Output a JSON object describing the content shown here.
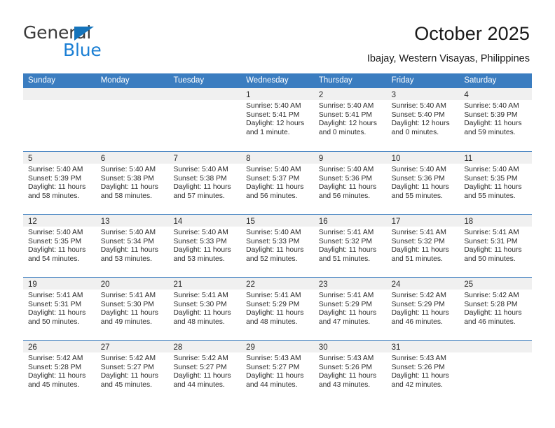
{
  "brand": {
    "name_part1": "General",
    "name_part2": "Blue",
    "accent_color": "#1b7fd4"
  },
  "header": {
    "title": "October 2025",
    "subtitle": "Ibajay, Western Visayas, Philippines"
  },
  "calendar": {
    "header_bg": "#3b7dc0",
    "weekdays": [
      "Sunday",
      "Monday",
      "Tuesday",
      "Wednesday",
      "Thursday",
      "Friday",
      "Saturday"
    ],
    "weeks": [
      [
        {
          "day": "",
          "sunrise": "",
          "sunset": "",
          "daylight1": "",
          "daylight2": ""
        },
        {
          "day": "",
          "sunrise": "",
          "sunset": "",
          "daylight1": "",
          "daylight2": ""
        },
        {
          "day": "",
          "sunrise": "",
          "sunset": "",
          "daylight1": "",
          "daylight2": ""
        },
        {
          "day": "1",
          "sunrise": "Sunrise: 5:40 AM",
          "sunset": "Sunset: 5:41 PM",
          "daylight1": "Daylight: 12 hours",
          "daylight2": "and 1 minute."
        },
        {
          "day": "2",
          "sunrise": "Sunrise: 5:40 AM",
          "sunset": "Sunset: 5:41 PM",
          "daylight1": "Daylight: 12 hours",
          "daylight2": "and 0 minutes."
        },
        {
          "day": "3",
          "sunrise": "Sunrise: 5:40 AM",
          "sunset": "Sunset: 5:40 PM",
          "daylight1": "Daylight: 12 hours",
          "daylight2": "and 0 minutes."
        },
        {
          "day": "4",
          "sunrise": "Sunrise: 5:40 AM",
          "sunset": "Sunset: 5:39 PM",
          "daylight1": "Daylight: 11 hours",
          "daylight2": "and 59 minutes."
        }
      ],
      [
        {
          "day": "5",
          "sunrise": "Sunrise: 5:40 AM",
          "sunset": "Sunset: 5:39 PM",
          "daylight1": "Daylight: 11 hours",
          "daylight2": "and 58 minutes."
        },
        {
          "day": "6",
          "sunrise": "Sunrise: 5:40 AM",
          "sunset": "Sunset: 5:38 PM",
          "daylight1": "Daylight: 11 hours",
          "daylight2": "and 58 minutes."
        },
        {
          "day": "7",
          "sunrise": "Sunrise: 5:40 AM",
          "sunset": "Sunset: 5:38 PM",
          "daylight1": "Daylight: 11 hours",
          "daylight2": "and 57 minutes."
        },
        {
          "day": "8",
          "sunrise": "Sunrise: 5:40 AM",
          "sunset": "Sunset: 5:37 PM",
          "daylight1": "Daylight: 11 hours",
          "daylight2": "and 56 minutes."
        },
        {
          "day": "9",
          "sunrise": "Sunrise: 5:40 AM",
          "sunset": "Sunset: 5:36 PM",
          "daylight1": "Daylight: 11 hours",
          "daylight2": "and 56 minutes."
        },
        {
          "day": "10",
          "sunrise": "Sunrise: 5:40 AM",
          "sunset": "Sunset: 5:36 PM",
          "daylight1": "Daylight: 11 hours",
          "daylight2": "and 55 minutes."
        },
        {
          "day": "11",
          "sunrise": "Sunrise: 5:40 AM",
          "sunset": "Sunset: 5:35 PM",
          "daylight1": "Daylight: 11 hours",
          "daylight2": "and 55 minutes."
        }
      ],
      [
        {
          "day": "12",
          "sunrise": "Sunrise: 5:40 AM",
          "sunset": "Sunset: 5:35 PM",
          "daylight1": "Daylight: 11 hours",
          "daylight2": "and 54 minutes."
        },
        {
          "day": "13",
          "sunrise": "Sunrise: 5:40 AM",
          "sunset": "Sunset: 5:34 PM",
          "daylight1": "Daylight: 11 hours",
          "daylight2": "and 53 minutes."
        },
        {
          "day": "14",
          "sunrise": "Sunrise: 5:40 AM",
          "sunset": "Sunset: 5:33 PM",
          "daylight1": "Daylight: 11 hours",
          "daylight2": "and 53 minutes."
        },
        {
          "day": "15",
          "sunrise": "Sunrise: 5:40 AM",
          "sunset": "Sunset: 5:33 PM",
          "daylight1": "Daylight: 11 hours",
          "daylight2": "and 52 minutes."
        },
        {
          "day": "16",
          "sunrise": "Sunrise: 5:41 AM",
          "sunset": "Sunset: 5:32 PM",
          "daylight1": "Daylight: 11 hours",
          "daylight2": "and 51 minutes."
        },
        {
          "day": "17",
          "sunrise": "Sunrise: 5:41 AM",
          "sunset": "Sunset: 5:32 PM",
          "daylight1": "Daylight: 11 hours",
          "daylight2": "and 51 minutes."
        },
        {
          "day": "18",
          "sunrise": "Sunrise: 5:41 AM",
          "sunset": "Sunset: 5:31 PM",
          "daylight1": "Daylight: 11 hours",
          "daylight2": "and 50 minutes."
        }
      ],
      [
        {
          "day": "19",
          "sunrise": "Sunrise: 5:41 AM",
          "sunset": "Sunset: 5:31 PM",
          "daylight1": "Daylight: 11 hours",
          "daylight2": "and 50 minutes."
        },
        {
          "day": "20",
          "sunrise": "Sunrise: 5:41 AM",
          "sunset": "Sunset: 5:30 PM",
          "daylight1": "Daylight: 11 hours",
          "daylight2": "and 49 minutes."
        },
        {
          "day": "21",
          "sunrise": "Sunrise: 5:41 AM",
          "sunset": "Sunset: 5:30 PM",
          "daylight1": "Daylight: 11 hours",
          "daylight2": "and 48 minutes."
        },
        {
          "day": "22",
          "sunrise": "Sunrise: 5:41 AM",
          "sunset": "Sunset: 5:29 PM",
          "daylight1": "Daylight: 11 hours",
          "daylight2": "and 48 minutes."
        },
        {
          "day": "23",
          "sunrise": "Sunrise: 5:41 AM",
          "sunset": "Sunset: 5:29 PM",
          "daylight1": "Daylight: 11 hours",
          "daylight2": "and 47 minutes."
        },
        {
          "day": "24",
          "sunrise": "Sunrise: 5:42 AM",
          "sunset": "Sunset: 5:29 PM",
          "daylight1": "Daylight: 11 hours",
          "daylight2": "and 46 minutes."
        },
        {
          "day": "25",
          "sunrise": "Sunrise: 5:42 AM",
          "sunset": "Sunset: 5:28 PM",
          "daylight1": "Daylight: 11 hours",
          "daylight2": "and 46 minutes."
        }
      ],
      [
        {
          "day": "26",
          "sunrise": "Sunrise: 5:42 AM",
          "sunset": "Sunset: 5:28 PM",
          "daylight1": "Daylight: 11 hours",
          "daylight2": "and 45 minutes."
        },
        {
          "day": "27",
          "sunrise": "Sunrise: 5:42 AM",
          "sunset": "Sunset: 5:27 PM",
          "daylight1": "Daylight: 11 hours",
          "daylight2": "and 45 minutes."
        },
        {
          "day": "28",
          "sunrise": "Sunrise: 5:42 AM",
          "sunset": "Sunset: 5:27 PM",
          "daylight1": "Daylight: 11 hours",
          "daylight2": "and 44 minutes."
        },
        {
          "day": "29",
          "sunrise": "Sunrise: 5:43 AM",
          "sunset": "Sunset: 5:27 PM",
          "daylight1": "Daylight: 11 hours",
          "daylight2": "and 44 minutes."
        },
        {
          "day": "30",
          "sunrise": "Sunrise: 5:43 AM",
          "sunset": "Sunset: 5:26 PM",
          "daylight1": "Daylight: 11 hours",
          "daylight2": "and 43 minutes."
        },
        {
          "day": "31",
          "sunrise": "Sunrise: 5:43 AM",
          "sunset": "Sunset: 5:26 PM",
          "daylight1": "Daylight: 11 hours",
          "daylight2": "and 42 minutes."
        },
        {
          "day": "",
          "sunrise": "",
          "sunset": "",
          "daylight1": "",
          "daylight2": ""
        }
      ]
    ]
  }
}
